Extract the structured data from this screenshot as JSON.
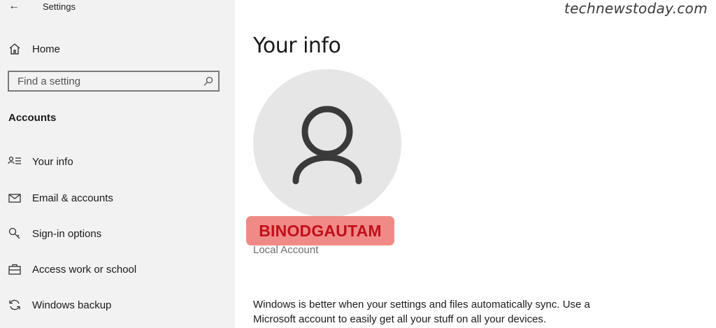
{
  "app": {
    "title": "Settings",
    "watermark": "technewstoday.com"
  },
  "sidebar": {
    "home_label": "Home",
    "search": {
      "placeholder": "Find a setting"
    },
    "section_header": "Accounts",
    "items": [
      {
        "label": "Your info",
        "icon": "your-info-icon"
      },
      {
        "label": "Email & accounts",
        "icon": "mail-icon"
      },
      {
        "label": "Sign-in options",
        "icon": "key-icon"
      },
      {
        "label": "Access work or school",
        "icon": "briefcase-icon"
      },
      {
        "label": "Windows backup",
        "icon": "sync-icon"
      }
    ]
  },
  "main": {
    "title": "Your info",
    "username": "BINODGAUTAM",
    "account_type": "Local Account",
    "sync_message": "Windows is better when your settings and files automatically sync. Use a Microsoft account to easily get all your stuff on all your devices."
  },
  "colors": {
    "sidebar_bg": "#f2f2f2",
    "avatar_bg": "#e6e6e6",
    "highlight": "#f08a86",
    "username_text": "#c0101a"
  }
}
